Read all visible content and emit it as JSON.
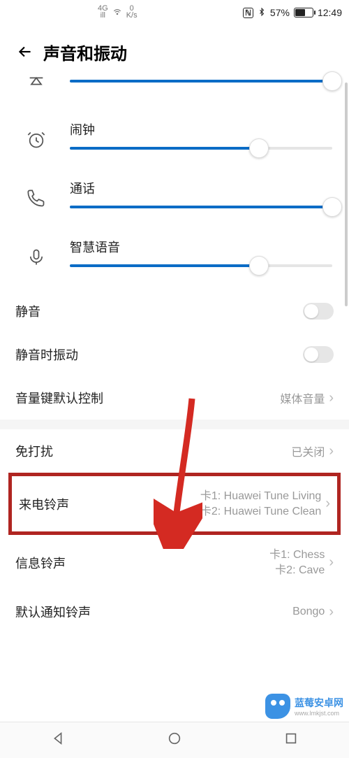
{
  "status": {
    "net_top": "4G",
    "net_bot": "ill",
    "speed_top": "0",
    "speed_bot": "K/s",
    "nfc": "ℕ",
    "bt_pct": "57%",
    "time": "12:49"
  },
  "header": {
    "title": "声音和振动"
  },
  "sliders": {
    "media": {
      "pct": 100
    },
    "alarm": {
      "label": "闹钟",
      "pct": 72
    },
    "call": {
      "label": "通话",
      "pct": 100
    },
    "voice": {
      "label": "智慧语音",
      "pct": 72
    }
  },
  "rows": {
    "mute": {
      "label": "静音"
    },
    "mute_vibrate": {
      "label": "静音时振动"
    },
    "volkey": {
      "label": "音量键默认控制",
      "value": "媒体音量"
    },
    "dnd": {
      "label": "免打扰",
      "value": "已关闭"
    },
    "ringtone": {
      "label": "来电铃声",
      "line1": "卡1: Huawei Tune Living",
      "line2": "卡2: Huawei Tune Clean"
    },
    "message": {
      "label": "信息铃声",
      "line1": "卡1: Chess",
      "line2": "卡2: Cave"
    },
    "notif": {
      "label": "默认通知铃声",
      "value": "Bongo"
    }
  },
  "watermark": {
    "title": "蓝莓安卓网",
    "url": "www.lmkjst.com"
  }
}
